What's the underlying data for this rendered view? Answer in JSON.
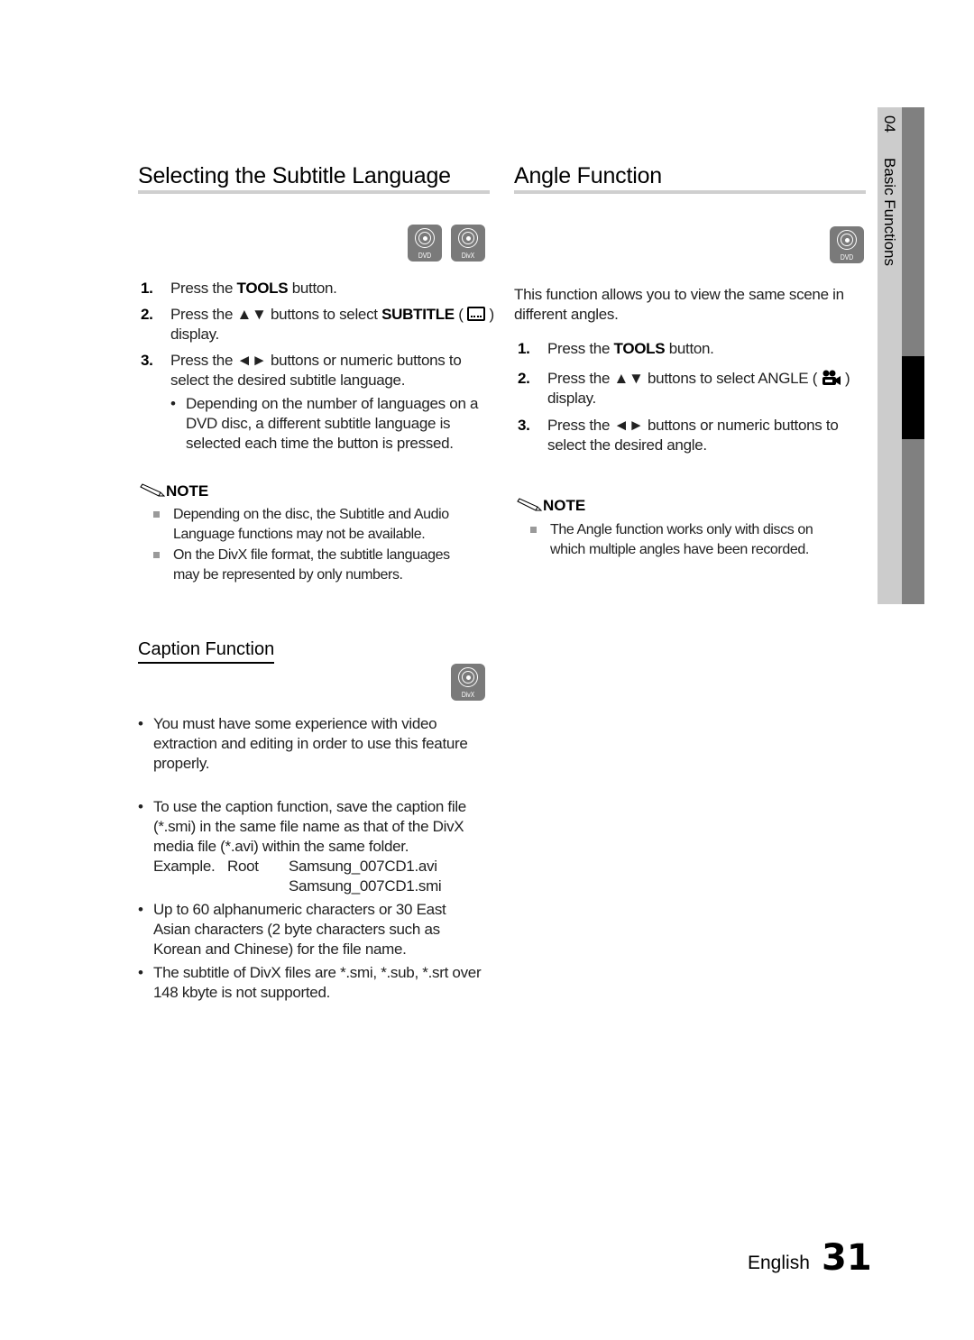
{
  "side_tab": {
    "chapter_number": "04",
    "chapter_title": "Basic Functions"
  },
  "subtitle_section": {
    "title": "Selecting the Subtitle Language",
    "badges": [
      "DVD",
      "DivX"
    ],
    "steps": [
      {
        "num": "1.",
        "pre": "Press the ",
        "bold": "TOOLS",
        "post": " button."
      },
      {
        "num": "2.",
        "pre": "Press the ▲▼ buttons to select ",
        "bold": "SUBTITLE",
        "post_icon": "subtitle-icon",
        "line2": "display."
      },
      {
        "num": "3.",
        "line1": "Press the ◄► buttons or numeric buttons to",
        "line2": "select the desired subtitle language."
      }
    ],
    "step3_bullet": [
      "Depending on the number of languages on a",
      "DVD disc, a different subtitle language is",
      "selected each time the button is pressed."
    ],
    "note_label": "NOTE",
    "notes": [
      [
        "Depending on the disc, the Subtitle and Audio",
        "Language functions may not be available."
      ],
      [
        "On the DivX file format, the subtitle languages",
        "may be represented by only numbers."
      ]
    ]
  },
  "caption_section": {
    "title": "Caption Function",
    "badges": [
      "DivX"
    ],
    "bullets": [
      [
        "You must have some experience with video",
        "extraction and editing in order to use this feature",
        "properly."
      ],
      [
        "To use the caption function, save the caption file",
        "(*.smi) in the same file name as that of the DivX",
        "media file (*.avi) within the same folder."
      ],
      [
        "Up to 60 alphanumeric characters or 30 East",
        "Asian characters (2 byte characters such as",
        "Korean and Chinese) for the file name."
      ],
      [
        "The subtitle of DivX files are *.smi, *.sub, *.srt over",
        "148 kbyte is not supported."
      ]
    ],
    "example": {
      "label": "Example.",
      "folder": "Root",
      "files": [
        "Samsung_007CD1.avi",
        "Samsung_007CD1.smi"
      ]
    }
  },
  "angle_section": {
    "title": "Angle Function",
    "badges": [
      "DVD"
    ],
    "intro": [
      "This function allows you to view the same scene in",
      "different angles."
    ],
    "steps": [
      {
        "num": "1.",
        "pre": "Press the ",
        "bold": "TOOLS",
        "post": " button."
      },
      {
        "num": "2.",
        "line1": "Press the ▲▼ buttons to select ANGLE ( ",
        "icon": "camera-icon",
        "line1_end": " )",
        "line2": "display."
      },
      {
        "num": "3.",
        "line1": "Press the ◄► buttons or numeric buttons to",
        "line2": "select the desired angle."
      }
    ],
    "note_label": "NOTE",
    "notes": [
      [
        "The Angle function works only with discs on",
        "which multiple angles have been recorded."
      ]
    ]
  },
  "footer": {
    "language": "English",
    "page_number": "31"
  }
}
